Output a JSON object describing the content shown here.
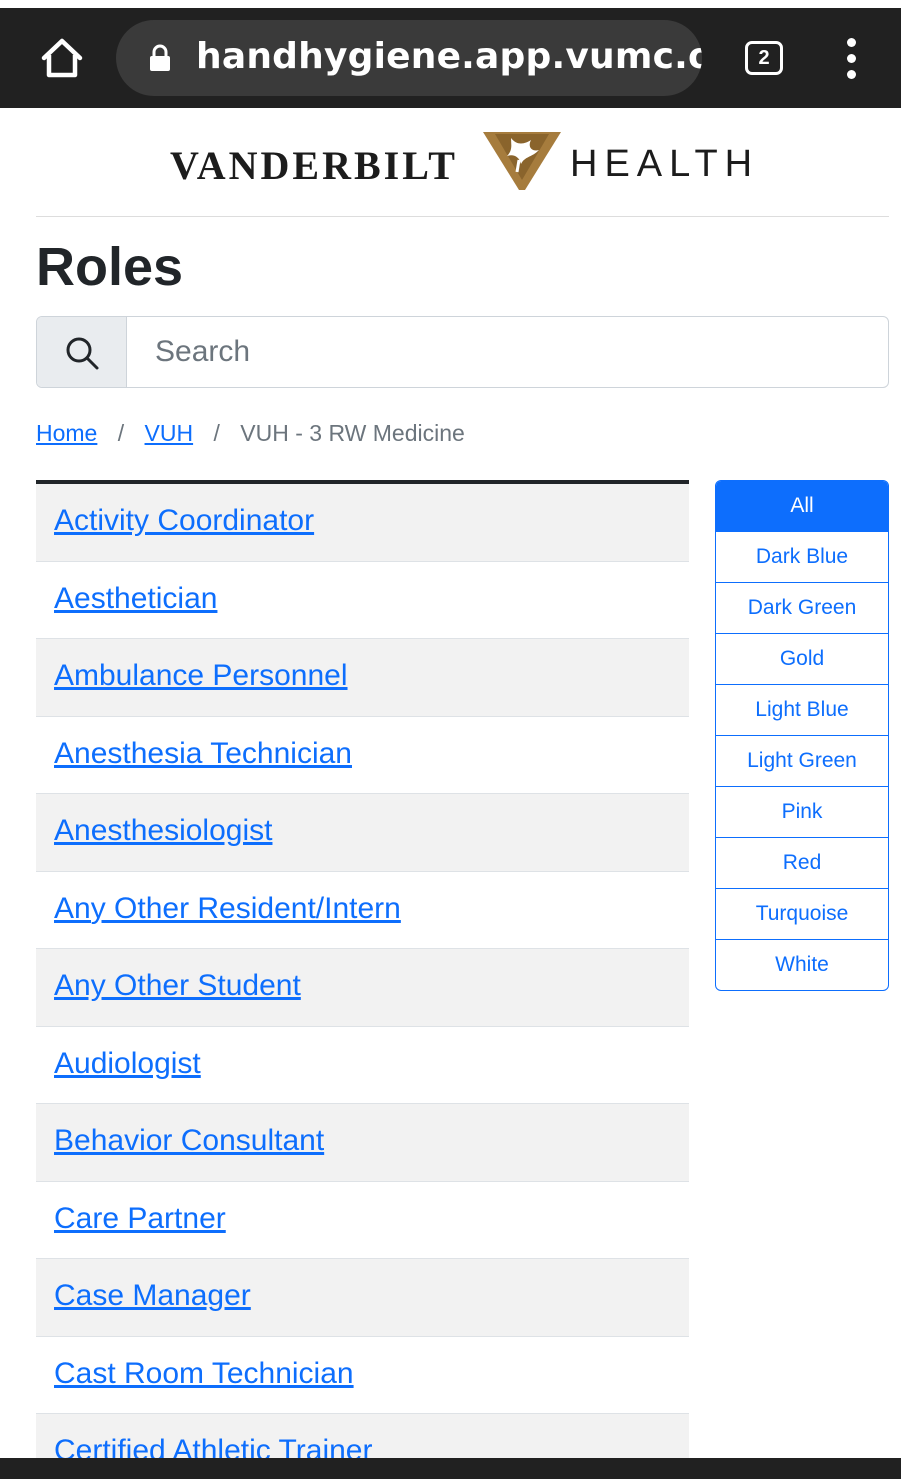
{
  "browser": {
    "url": "handhygiene.app.vumc.org/#",
    "tab_count": "2"
  },
  "logo": {
    "left_text": "VANDERBILT",
    "right_text": "HEALTH",
    "brand_color": "#a67c3d"
  },
  "page": {
    "title": "Roles"
  },
  "search": {
    "placeholder": "Search",
    "value": ""
  },
  "breadcrumb": {
    "items": [
      "Home",
      "VUH"
    ],
    "separator": "/",
    "current": "VUH - 3 RW Medicine"
  },
  "roles": [
    "Activity Coordinator",
    "Aesthetician",
    "Ambulance Personnel",
    "Anesthesia Technician",
    "Anesthesiologist",
    "Any Other Resident/Intern",
    "Any Other Student",
    "Audiologist",
    "Behavior Consultant",
    "Care Partner",
    "Case Manager",
    "Cast Room Technician",
    "Certified Athletic Trainer"
  ],
  "color_filter": {
    "options": [
      "All",
      "Dark Blue",
      "Dark Green",
      "Gold",
      "Light Blue",
      "Light Green",
      "Pink",
      "Red",
      "Turquoise",
      "White"
    ],
    "selected": "All",
    "accent_color": "#0d6efd"
  },
  "icons": {
    "home": "home-icon",
    "lock": "lock-icon",
    "tabs": "tab-switcher-icon",
    "menu": "overflow-menu-icon",
    "search": "search-icon"
  }
}
